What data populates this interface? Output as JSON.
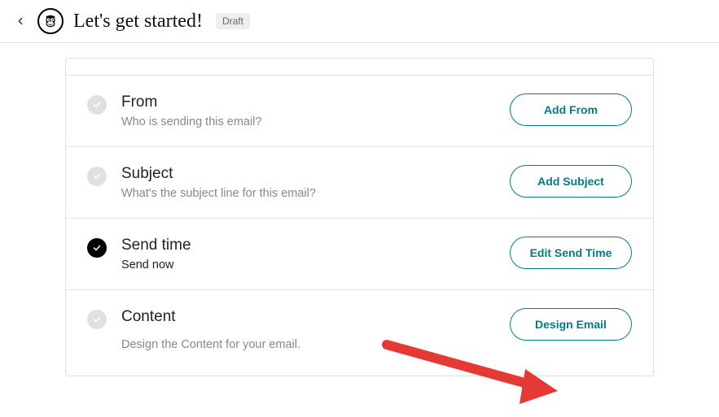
{
  "header": {
    "title": "Let's get started!",
    "badge": "Draft"
  },
  "sections": {
    "from": {
      "title": "From",
      "desc": "Who is sending this email?",
      "button": "Add From"
    },
    "subject": {
      "title": "Subject",
      "desc": "What's the subject line for this email?",
      "button": "Add Subject"
    },
    "sendtime": {
      "title": "Send time",
      "desc": "Send now",
      "button": "Edit Send Time"
    },
    "content": {
      "title": "Content",
      "desc": "Design the Content for your email.",
      "button": "Design Email"
    }
  }
}
